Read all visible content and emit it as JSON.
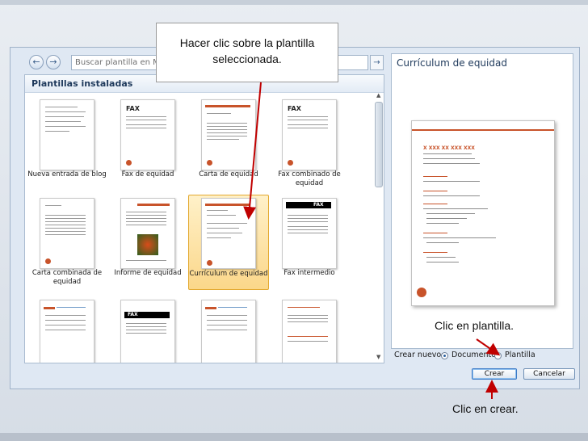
{
  "toolbar": {
    "back_label": "←",
    "forward_label": "→",
    "search_placeholder": "Buscar plantilla en Microsoft Office Online",
    "search_go": "→"
  },
  "left_pane": {
    "header": "Plantillas instaladas",
    "templates": [
      {
        "label": "Nueva entrada de blog",
        "selected": false
      },
      {
        "label": "Fax de equidad",
        "selected": false
      },
      {
        "label": "Carta de equidad",
        "selected": false
      },
      {
        "label": "Fax combinado de equidad",
        "selected": false
      },
      {
        "label": "Carta combinada de equidad",
        "selected": false
      },
      {
        "label": "Informe de equidad",
        "selected": false
      },
      {
        "label": "Currículum de equidad",
        "selected": true
      },
      {
        "label": "Fax intermedio",
        "selected": false
      }
    ],
    "fax_word": "FAX"
  },
  "preview": {
    "title": "Currículum de equidad",
    "doc_name": "X XXX XX XXX XXX"
  },
  "create_new": {
    "label": "Crear nuevo:",
    "option_document": "Documento",
    "option_template": "Plantilla",
    "selected": "Documento"
  },
  "buttons": {
    "create": "Crear",
    "cancel": "Cancelar"
  },
  "callouts": {
    "top": "Hacer clic sobre la plantilla seleccionada.",
    "template": "Clic en plantilla.",
    "create": "Clic en crear."
  },
  "colors": {
    "accent_orange": "#c8532a",
    "arrow_red": "#c00000",
    "selection": "#fbd78a"
  }
}
